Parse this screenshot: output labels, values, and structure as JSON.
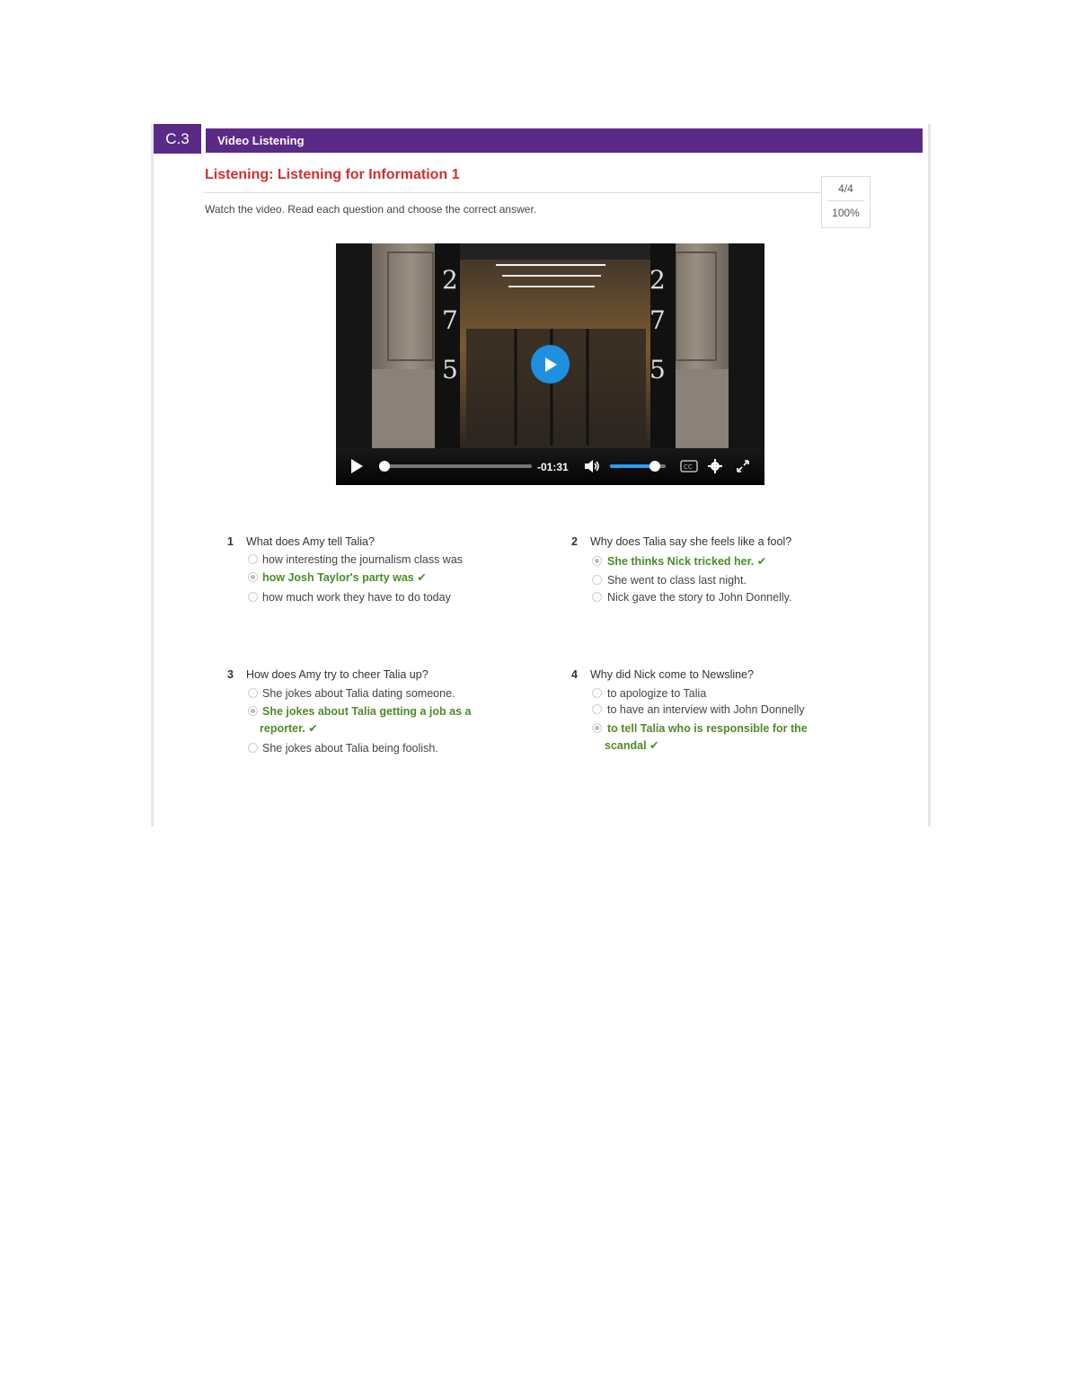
{
  "header": {
    "section_code": "C.3",
    "section_title": "Video Listening"
  },
  "activity": {
    "title": "Listening: Listening for Information 1",
    "instruction": "Watch the video. Read each question and choose the correct answer.",
    "score_fraction": "4/4",
    "score_percent": "100%"
  },
  "video": {
    "time_remaining": "-01:31",
    "progress": 0.0,
    "volume": 0.78,
    "building_number": "275"
  },
  "questions": [
    {
      "number": "1",
      "text": "What does Amy tell Talia?",
      "options": [
        {
          "text": "how interesting the journalism class was",
          "selected": false,
          "correct": false
        },
        {
          "text": "how Josh Taylor's party was",
          "selected": true,
          "correct": true
        },
        {
          "text": "how much work they have to do today",
          "selected": false,
          "correct": false
        }
      ]
    },
    {
      "number": "2",
      "text": "Why does Talia say she feels like a fool?",
      "options": [
        {
          "text": "She thinks Nick tricked her.",
          "selected": true,
          "correct": true
        },
        {
          "text": "She went to class last night.",
          "selected": false,
          "correct": false
        },
        {
          "text": "Nick gave the story to John Donnelly.",
          "selected": false,
          "correct": false
        }
      ]
    },
    {
      "number": "3",
      "text": "How does Amy try to cheer Talia up?",
      "options": [
        {
          "text": "She jokes about Talia dating someone.",
          "selected": false,
          "correct": false
        },
        {
          "text": "She jokes about Talia getting a job as a",
          "text_line2": "reporter.",
          "selected": true,
          "correct": true
        },
        {
          "text": "She jokes about Talia being foolish.",
          "selected": false,
          "correct": false
        }
      ]
    },
    {
      "number": "4",
      "text": "Why did Nick come to Newsline?",
      "options": [
        {
          "text": "to apologize to Talia",
          "selected": false,
          "correct": false
        },
        {
          "text": "to have an interview with John Donnelly",
          "selected": false,
          "correct": false
        },
        {
          "text": "to tell Talia who is responsible for the",
          "text_line2": "scandal",
          "selected": true,
          "correct": true
        }
      ]
    }
  ],
  "check_mark": "✔"
}
